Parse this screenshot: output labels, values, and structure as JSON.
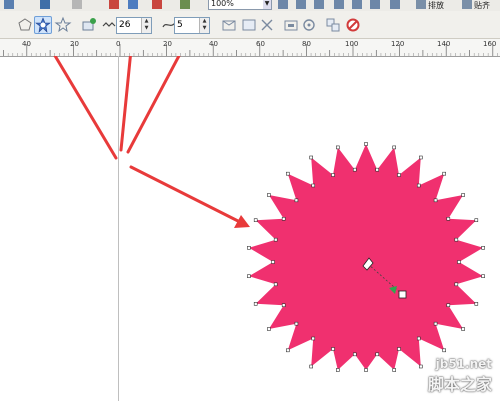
{
  "toolbar_top": {
    "zoom_value": "100%",
    "button_a_label": "排放",
    "button_b_label": "贴齐"
  },
  "property_bar": {
    "points_value": "26",
    "sharpness_value": "5",
    "icons": [
      "polygon-icon",
      "star-icon",
      "complex-star-icon",
      "polygon-to-star-icon",
      "points-icon",
      "sharpness-icon",
      "wrap-icon",
      "bring-front-icon",
      "back-icon",
      "convert-icon",
      "outline-icon",
      "clear-icon"
    ]
  },
  "ruler": {
    "ticks": [
      "40",
      "20",
      "0",
      "20",
      "40",
      "60",
      "80",
      "100",
      "120",
      "140",
      "160"
    ]
  },
  "shape": {
    "fill_color": "#f0306f",
    "type": "star",
    "points": 26
  },
  "watermark": {
    "url": "jb51.net",
    "name": "脚本之家"
  },
  "annotation_color": "#e83a3a"
}
